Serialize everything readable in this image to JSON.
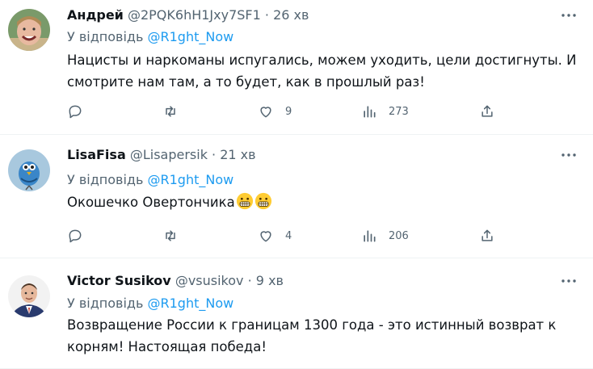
{
  "tweets": [
    {
      "name": "Андрей",
      "handle": "@2PQK6hH1Jxy7SF1",
      "time": "26 хв",
      "reply_prefix": "У відповідь",
      "reply_to": "@R1ght_Now",
      "text": "Нацисты и наркоманы испугались, можем уходить, цели достигнуты. И смотрите нам там, а то будет, как в прошлый раз!",
      "likes": "9",
      "views": "273"
    },
    {
      "name": "LisaFisa",
      "handle": "@Lisapersik",
      "time": "21 хв",
      "reply_prefix": "У відповідь",
      "reply_to": "@R1ght_Now",
      "text": "Окошечко Овертончика",
      "likes": "4",
      "views": "206"
    },
    {
      "name": "Victor Susikov",
      "handle": "@vsusikov",
      "time": "9 хв",
      "reply_prefix": "У відповідь",
      "reply_to": "@R1ght_Now",
      "text": "Возвращение России к границам 1300 года - это истинный возврат к корням! Настоящая победа!"
    }
  ],
  "separator": "·",
  "icons": [
    "more-icon",
    "reply-icon",
    "retweet-icon",
    "like-icon",
    "views-icon",
    "share-icon",
    "grimacing-emoji-icon"
  ],
  "colors": {
    "text": "#0f1419",
    "secondary": "#536471",
    "link": "#1d9bf0",
    "divider": "#eff3f4"
  }
}
